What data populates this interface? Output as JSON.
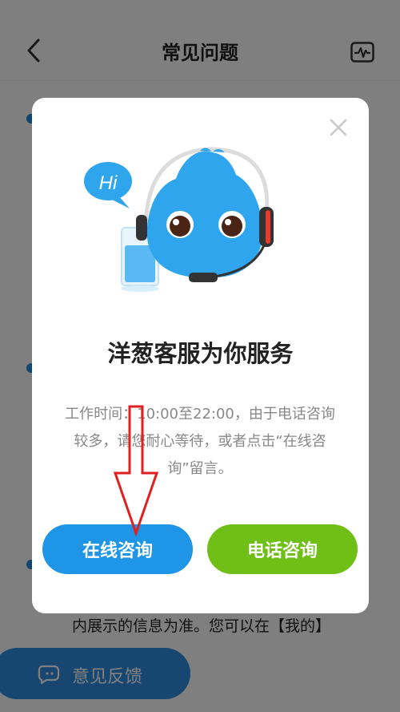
{
  "header": {
    "title": "常见问题"
  },
  "background": {
    "partial_text": "内展示的信息为准。您可以在【我的】",
    "feedback_label": "意见反馈"
  },
  "dialog": {
    "mascot_bubble": "Hi",
    "title": "洋葱客服为你服务",
    "description": "工作时间：10:00至22:00，由于电话咨询较多，请您耐心等待，或者点击“在线咨询”留言。",
    "online_button": "在线咨询",
    "phone_button": "电话咨询"
  },
  "colors": {
    "online_button": "#1e95e6",
    "phone_button": "#6fbf16",
    "annotation_arrow": "#e02020",
    "mascot": "#2fa5ee"
  }
}
